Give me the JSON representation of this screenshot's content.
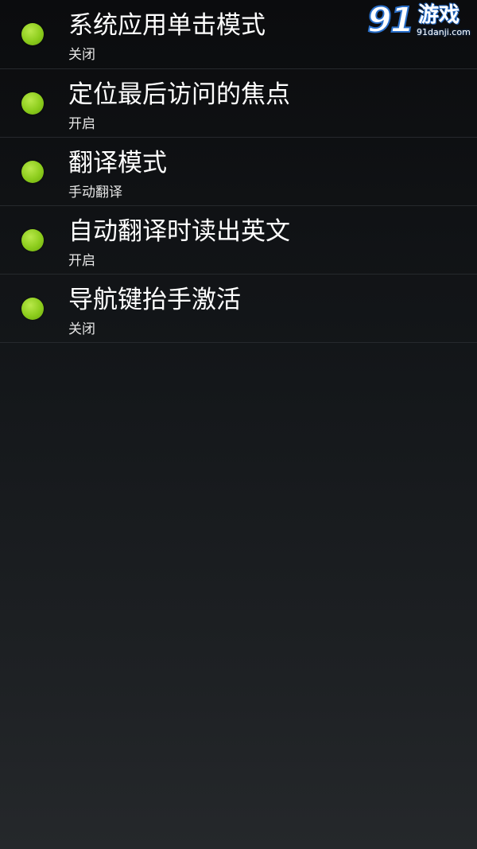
{
  "watermark": {
    "number": "91",
    "name": "游戏",
    "url": "91danji.com"
  },
  "colors": {
    "indicator": "#8ccc1c",
    "background_top": "#0b0c0e",
    "background_bottom": "#25282b",
    "divider": "#26292d"
  },
  "settings": [
    {
      "title": "系统应用单击模式",
      "summary": "关闭",
      "icon": "green-dot-icon"
    },
    {
      "title": "定位最后访问的焦点",
      "summary": "开启",
      "icon": "green-dot-icon"
    },
    {
      "title": "翻译模式",
      "summary": "手动翻译",
      "icon": "green-dot-icon"
    },
    {
      "title": "自动翻译时读出英文",
      "summary": "开启",
      "icon": "green-dot-icon"
    },
    {
      "title": "导航键抬手激活",
      "summary": "关闭",
      "icon": "green-dot-icon"
    }
  ]
}
